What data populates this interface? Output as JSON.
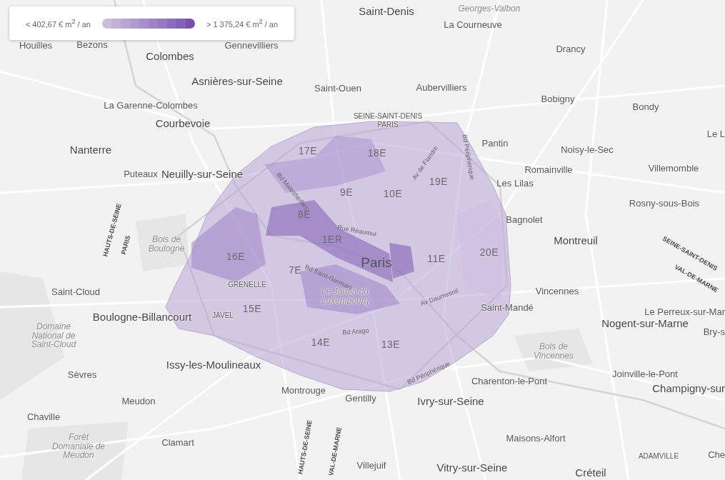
{
  "legend": {
    "min_label": "< 402,67 € m$^{2}$ / an",
    "max_label": "> 1 375,24 € m$^{2}$ / an",
    "steps": [
      {
        "color": "#cbbde0"
      },
      {
        "color": "#c2b1db"
      },
      {
        "color": "#b9a6d6"
      },
      {
        "color": "#b09ad1"
      },
      {
        "color": "#a78fcc"
      },
      {
        "color": "#9e84c7"
      },
      {
        "color": "#9579c2"
      },
      {
        "color": "#8c6dbd"
      },
      {
        "color": "#8362b8"
      },
      {
        "color": "#7a4fb0"
      }
    ]
  },
  "map": {
    "places": [
      {
        "kind": "major",
        "label": "Saint-Denis"
      },
      {
        "kind": "park",
        "label": "Georges-Valbon"
      },
      {
        "kind": "city",
        "label": "La Courneuve"
      },
      {
        "kind": "city",
        "label": "Houilles"
      },
      {
        "kind": "city",
        "label": "Bezons"
      },
      {
        "kind": "major",
        "label": "Colombes"
      },
      {
        "kind": "city",
        "label": "Gennevilliers"
      },
      {
        "kind": "city",
        "label": "Drancy"
      },
      {
        "kind": "major",
        "label": "Asnières-sur-Seine"
      },
      {
        "kind": "city",
        "label": "Saint-Ouen"
      },
      {
        "kind": "city",
        "label": "Aubervilliers"
      },
      {
        "kind": "city",
        "label": "Bobigny"
      },
      {
        "kind": "city",
        "label": "La Garenne-Colombes"
      },
      {
        "kind": "city",
        "label": "Bondy"
      },
      {
        "kind": "major",
        "label": "Courbevoie"
      },
      {
        "kind": "district",
        "label": "SEINE-SAINT-DENIS"
      },
      {
        "kind": "district",
        "label": "PARIS"
      },
      {
        "kind": "city",
        "label": "Pantin"
      },
      {
        "kind": "city",
        "label": "Le L"
      },
      {
        "kind": "major",
        "label": "Nanterre"
      },
      {
        "kind": "city",
        "label": "Noisy-le-Sec"
      },
      {
        "kind": "city",
        "label": "Puteaux"
      },
      {
        "kind": "major",
        "label": "Neuilly-sur-Seine"
      },
      {
        "kind": "city",
        "label": "Romainville"
      },
      {
        "kind": "city",
        "label": "Villemomble"
      },
      {
        "kind": "city",
        "label": "Les Lilas"
      },
      {
        "kind": "city",
        "label": "Rosny-sous-Bois"
      },
      {
        "kind": "city",
        "label": "Bagnolet"
      },
      {
        "kind": "major",
        "label": "Montreuil"
      },
      {
        "kind": "capital",
        "label": "Paris"
      },
      {
        "kind": "arr",
        "label": "17E"
      },
      {
        "kind": "arr",
        "label": "18E"
      },
      {
        "kind": "arr",
        "label": "9E"
      },
      {
        "kind": "arr",
        "label": "10E"
      },
      {
        "kind": "arr",
        "label": "19E"
      },
      {
        "kind": "arr",
        "label": "8E"
      },
      {
        "kind": "arr",
        "label": "1ER"
      },
      {
        "kind": "arr",
        "label": "16E"
      },
      {
        "kind": "arr",
        "label": "11E"
      },
      {
        "kind": "arr",
        "label": "20E"
      },
      {
        "kind": "arr",
        "label": "7E"
      },
      {
        "kind": "arr",
        "label": "15E"
      },
      {
        "kind": "arr",
        "label": "14E"
      },
      {
        "kind": "arr",
        "label": "13E"
      },
      {
        "kind": "park",
        "label": "Bois de Boulogne"
      },
      {
        "kind": "park",
        "label": "Le Jardin du Luxembourg"
      },
      {
        "kind": "park",
        "label": "Bois de Vincennes"
      },
      {
        "kind": "park",
        "label": "Domaine National de Saint-Cloud"
      },
      {
        "kind": "park",
        "label": "Forêt Domaniale de Meudon"
      },
      {
        "kind": "district",
        "label": "GRENELLE"
      },
      {
        "kind": "district",
        "label": "JAVEL"
      },
      {
        "kind": "city",
        "label": "Saint-Cloud"
      },
      {
        "kind": "major",
        "label": "Boulogne-Billancourt"
      },
      {
        "kind": "city",
        "label": "Vincennes"
      },
      {
        "kind": "city",
        "label": "Saint-Mandé"
      },
      {
        "kind": "city",
        "label": "Le Perreux-sur-Mar"
      },
      {
        "kind": "major",
        "label": "Nogent-sur-Marne"
      },
      {
        "kind": "city",
        "label": "Bry-s"
      },
      {
        "kind": "major",
        "label": "Issy-les-Moulineaux"
      },
      {
        "kind": "city",
        "label": "Sèvres"
      },
      {
        "kind": "city",
        "label": "Joinville-le-Pont"
      },
      {
        "kind": "city",
        "label": "Charenton-le-Pont"
      },
      {
        "kind": "city",
        "label": "Meudon"
      },
      {
        "kind": "city",
        "label": "Montrouge"
      },
      {
        "kind": "city",
        "label": "Gentilly"
      },
      {
        "kind": "major",
        "label": "Ivry-sur-Seine"
      },
      {
        "kind": "major",
        "label": "Champigny-sur"
      },
      {
        "kind": "city",
        "label": "Chaville"
      },
      {
        "kind": "city",
        "label": "Maisons-Alfort"
      },
      {
        "kind": "city",
        "label": "Clamart"
      },
      {
        "kind": "city",
        "label": "Villejuif"
      },
      {
        "kind": "major",
        "label": "Vitry-sur-Seine"
      },
      {
        "kind": "major",
        "label": "Créteil"
      },
      {
        "kind": "district",
        "label": "ADAMVILLE"
      },
      {
        "kind": "city",
        "label": "Che"
      },
      {
        "kind": "street",
        "label": "Bd Malesherbes"
      },
      {
        "kind": "street",
        "label": "Rue Réaumur"
      },
      {
        "kind": "street",
        "label": "Bd Saint-Germain"
      },
      {
        "kind": "street",
        "label": "Av Daumesnil"
      },
      {
        "kind": "street",
        "label": "Bd Arago"
      },
      {
        "kind": "street",
        "label": "Bd Périphérique"
      },
      {
        "kind": "street",
        "label": "Av de Flandre"
      },
      {
        "kind": "street",
        "label": "Bd Périphérique"
      },
      {
        "kind": "dept",
        "label": "HAUTS-DE-SEINE"
      },
      {
        "kind": "dept",
        "label": "PARIS"
      },
      {
        "kind": "dept",
        "label": "SEINE-SAINT-DENIS"
      },
      {
        "kind": "dept",
        "label": "VAL-DE-MARNE"
      },
      {
        "kind": "dept",
        "label": "HAUTS-DE-SEINE"
      },
      {
        "kind": "dept",
        "label": "VAL-DE-MARNE"
      }
    ]
  }
}
